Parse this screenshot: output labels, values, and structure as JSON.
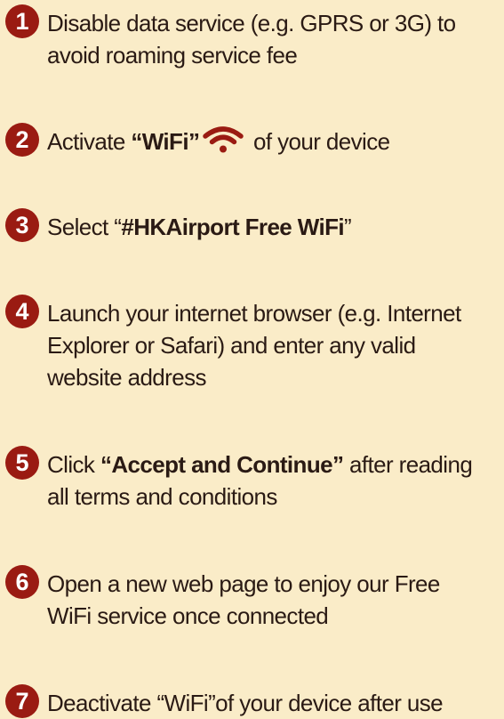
{
  "steps": [
    {
      "number": "1",
      "line1": "Disable data service (e.g. GPRS or 3G) to",
      "line2": "avoid roaming service fee"
    },
    {
      "number": "2",
      "prefix": "Activate ",
      "bold": "“WiFi”",
      "suffix": " of your device"
    },
    {
      "number": "3",
      "prefix": "Select “",
      "bold": "#HKAirport Free WiFi",
      "suffix": "”"
    },
    {
      "number": "4",
      "line1": "Launch your internet browser (e.g. Internet",
      "line2": "Explorer or Safari) and enter any valid",
      "line3": "website address"
    },
    {
      "number": "5",
      "prefix": "Click ",
      "bold": "“Accept and Continue”",
      "suffix": " after reading",
      "line2": "all terms and conditions"
    },
    {
      "number": "6",
      "line1": "Open a new web page to enjoy our Free",
      "line2": "WiFi service once connected"
    },
    {
      "number": "7",
      "line1": "Deactivate “WiFi”of your device after use"
    }
  ],
  "icons": {
    "wifi": "wifi-icon"
  },
  "colors": {
    "background": "#faecc8",
    "accent": "#9a1b12",
    "text": "#2a1a14"
  }
}
